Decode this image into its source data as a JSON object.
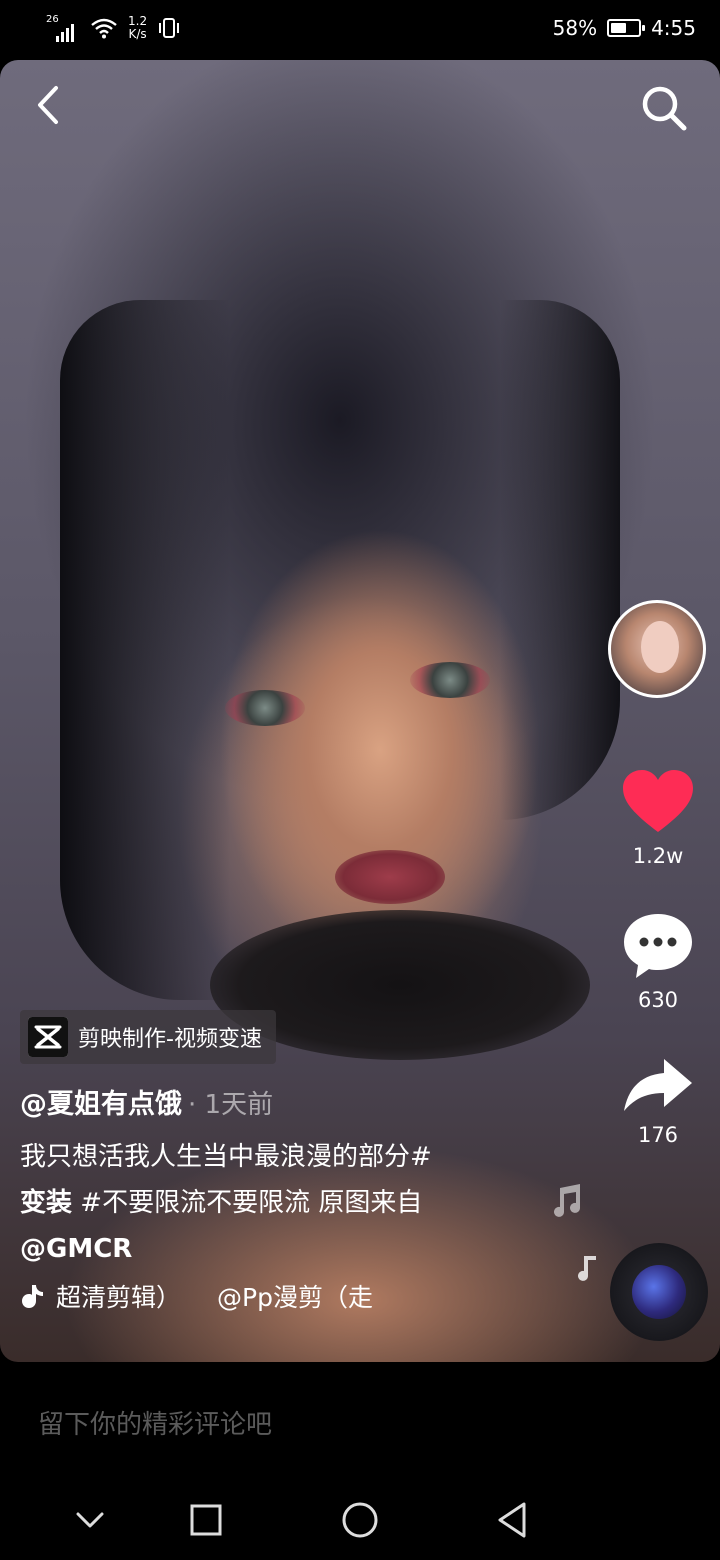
{
  "status_bar": {
    "network": "26",
    "speed": "1.2\nK/s",
    "speed_value": "1.2",
    "speed_unit": "K/s",
    "battery": "58%",
    "battery_level": 0.58,
    "time": "4:55"
  },
  "video": {
    "effect_tag": "剪映制作-视频变速",
    "author": "@夏姐有点饿",
    "time_ago": "· 1天前",
    "caption_line1": "我只想活我人生当中最浪漫的部分#",
    "caption_tag": "变装",
    "caption_line2": " #不要限流不要限流 原图来自",
    "caption_mention": "@GMCR",
    "music_left": "超清剪辑）",
    "music_right": "@Pp漫剪（走"
  },
  "actions": {
    "likes": "1.2w",
    "comments": "630",
    "shares": "176"
  },
  "comment_input": {
    "placeholder": "留下你的精彩评论吧"
  },
  "colors": {
    "like_red": "#fe2c55",
    "background": "#000000"
  },
  "icons": [
    "back-icon",
    "search-icon",
    "heart-icon",
    "comment-icon",
    "share-icon",
    "music-note-icon",
    "capcut-icon",
    "nav-back-icon",
    "nav-home-icon",
    "nav-recent-icon",
    "nav-down-icon"
  ]
}
